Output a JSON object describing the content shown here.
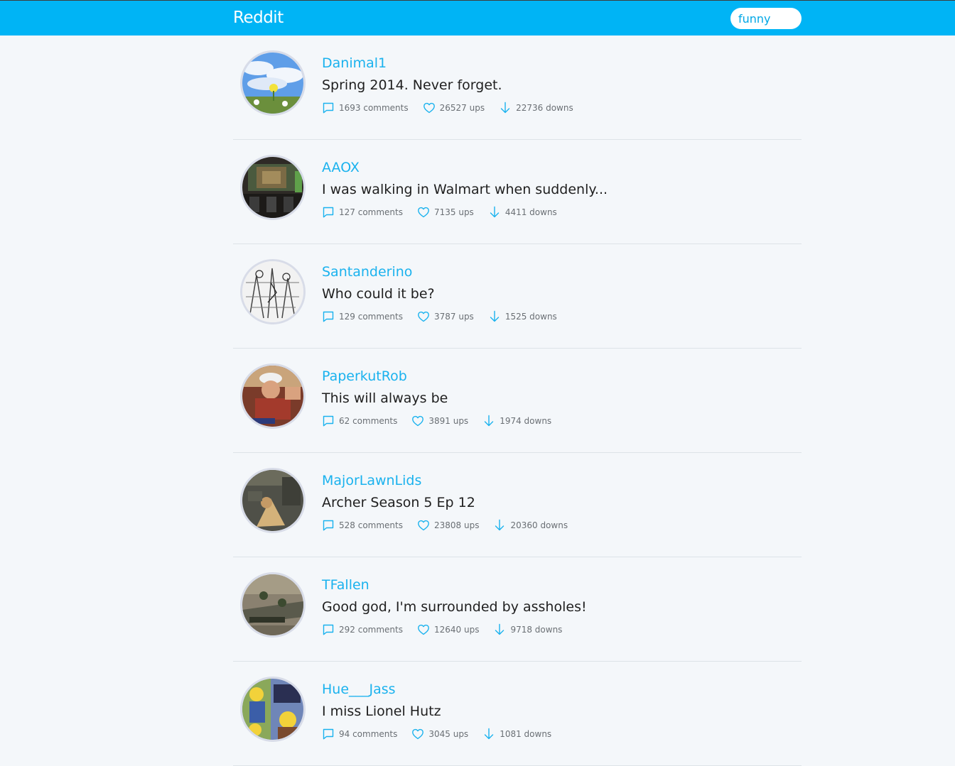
{
  "header": {
    "brand": "Reddit",
    "search_value": "funny"
  },
  "icons": {
    "comment": "comment-icon",
    "up": "heart-icon",
    "down": "arrow-down-icon"
  },
  "colors": {
    "accent": "#00b4f5",
    "link": "#1ab2ee",
    "background": "#f4f7fa"
  },
  "posts": [
    {
      "author": "Danimal1",
      "title": "Spring 2014. Never forget.",
      "comments": "1693 comments",
      "ups": "26527 ups",
      "downs": "22736 downs"
    },
    {
      "author": "AAOX",
      "title": "I was walking in Walmart when suddenly...",
      "comments": "127 comments",
      "ups": "7135 ups",
      "downs": "4411 downs"
    },
    {
      "author": "Santanderino",
      "title": "Who could it be?",
      "comments": "129 comments",
      "ups": "3787 ups",
      "downs": "1525 downs"
    },
    {
      "author": "PaperkutRob",
      "title": "This will always be",
      "comments": "62 comments",
      "ups": "3891 ups",
      "downs": "1974 downs"
    },
    {
      "author": "MajorLawnLids",
      "title": "Archer Season 5 Ep 12",
      "comments": "528 comments",
      "ups": "23808 ups",
      "downs": "20360 downs"
    },
    {
      "author": "TFallen",
      "title": "Good god, I'm surrounded by assholes!",
      "comments": "292 comments",
      "ups": "12640 ups",
      "downs": "9718 downs"
    },
    {
      "author": "Hue___Jass",
      "title": "I miss Lionel Hutz",
      "comments": "94 comments",
      "ups": "3045 ups",
      "downs": "1081 downs"
    }
  ]
}
